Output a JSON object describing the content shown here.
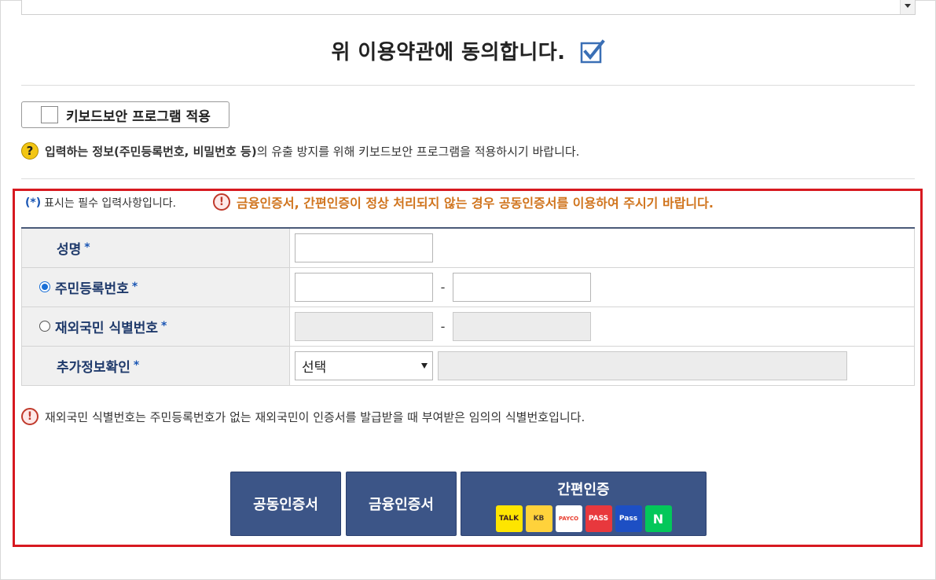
{
  "agree": {
    "text": "위 이용약관에 동의합니다.",
    "checked": true
  },
  "keyboard_security": {
    "button_label": "키보드보안 프로그램 적용",
    "note_bold": "입력하는 정보(주민등록번호, 비밀번호 등)",
    "note_rest": "의 유출 방지를 위해 키보드보안 프로그램을 적용하시기 바랍니다."
  },
  "notice": {
    "required_star": "(*)",
    "required_text": "표시는 필수 입력사항입니다.",
    "warning_text": "금융인증서, 간편인증이 정상 처리되지 않는 경우 공동인증서를 이용하여 주시기 바랍니다."
  },
  "form": {
    "name_label": "성명",
    "rrn_label": "주민등록번호",
    "foreign_label": "재외국민 식별번호",
    "extra_label": "추가정보확인",
    "star": "*",
    "dash": "-",
    "select_value": "선택",
    "rrn_selected": true
  },
  "foreign_note": "재외국민 식별번호는 주민등록번호가 없는 재외국민이 인증서를 발급받을 때 부여받은 임의의 식별번호입니다.",
  "buttons": {
    "joint_cert": "공동인증서",
    "financial_cert": "금융인증서",
    "easy_auth": "간편인증"
  },
  "easy_auth_logos": [
    {
      "icon": "kakao-talk-icon",
      "text": "TALK"
    },
    {
      "icon": "kb-icon",
      "text": "KB"
    },
    {
      "icon": "payco-icon",
      "text": "PAYCO"
    },
    {
      "icon": "pass-icon",
      "text": "PASS"
    },
    {
      "icon": "samsung-pass-icon",
      "text": "Pass"
    },
    {
      "icon": "naver-icon",
      "text": "N"
    }
  ],
  "colors": {
    "accent_red": "#d71920",
    "button_blue": "#3c5587",
    "label_blue": "#1f3a6b",
    "warning_orange": "#d0741d"
  }
}
